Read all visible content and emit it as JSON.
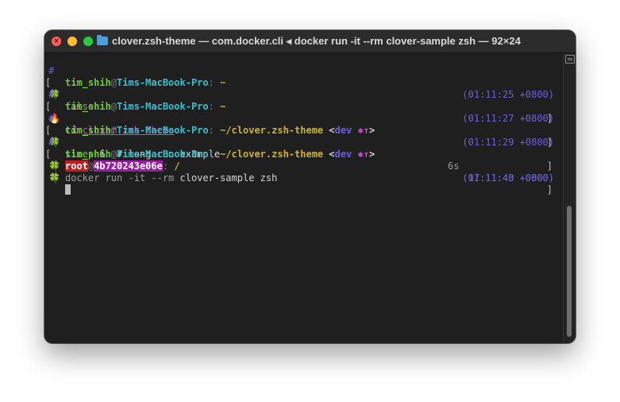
{
  "window": {
    "title": "clover.zsh-theme — com.docker.cli ◂ docker run -it --rm clover-sample zsh — 92×24",
    "close_glyph": "×"
  },
  "terminal": {
    "lines": [
      {
        "gutter": "#",
        "user": "tim_shih",
        "at": "@",
        "host": "Tims-MacBook-Pro",
        "colon": ":",
        "path": "~",
        "time": "(01:11:25 +0800)"
      },
      {
        "gutter": "[",
        "emoji": "🍀",
        "cmd": "false",
        "end": "]"
      },
      {
        "gutter": "#",
        "user": "tim_shih",
        "at": "@",
        "host": "Tims-MacBook-Pro",
        "colon": ":",
        "path": "~",
        "time": "(01:11:27 +0800)"
      },
      {
        "gutter": "[",
        "emoji": "🔥",
        "cmd": "cd",
        "arg": "clover.zsh-theme",
        "end": "]"
      },
      {
        "gutter": "#",
        "user": "tim_shih",
        "at": "@",
        "host": "Tims-MacBook-Pro",
        "colon": ":",
        "path": "~/clover.zsh-theme",
        "git_open": "<",
        "branch": "dev",
        "git_status": "✱↑",
        "git_close": ">",
        "time": "(01:11:29 +0800)"
      },
      {
        "gutter": "[",
        "emoji": "🍀",
        "cmd": "sleep",
        "args": " 6  # long run example",
        "end": "]"
      },
      {
        "gutter": "#",
        "user": "tim_shih",
        "at": "@",
        "host": "Tims-MacBook-Pro",
        "colon": ":",
        "path": "~/clover.zsh-theme",
        "git_open": "<",
        "branch": "dev",
        "git_status": "✱↑",
        "git_close": ">",
        "duration": "6s",
        "time": "(01:11:40 +0800)"
      },
      {
        "gutter": "[",
        "emoji": "🍀",
        "cmd": "docker run -it --rm",
        "args": " clover-sample zsh",
        "end": "]"
      },
      {
        "user": "root",
        "at": "@",
        "host": "4b720243e06e",
        "colon": ":",
        "path": "/",
        "time": "(17:11:43 +0000)"
      },
      {
        "emoji": "🍀"
      }
    ]
  },
  "colors": {
    "background": "#1f1f1f",
    "user": "#73c936",
    "host": "#36c0c9",
    "path": "#c9b236",
    "timestamp": "#6a5fe0",
    "git_status": "#d946d0",
    "root_bg": "#c21e1e",
    "container_bg": "#9a1ca3"
  }
}
